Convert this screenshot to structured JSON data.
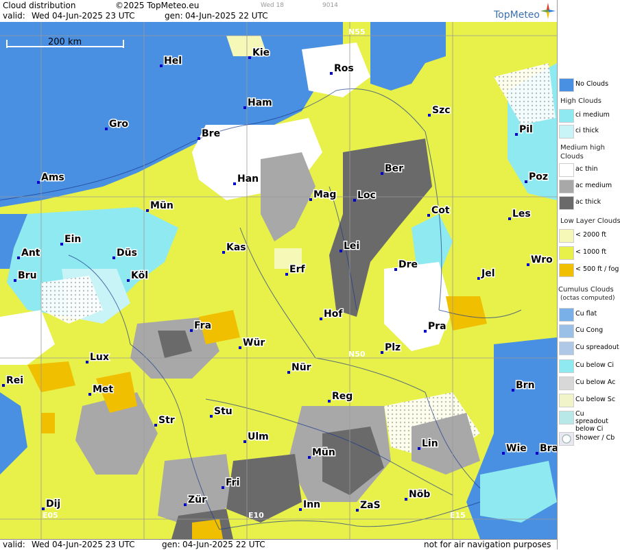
{
  "header": {
    "product": "Cloud distribution",
    "copyright": "©2025 TopMeteo.eu",
    "small_tag_1": "Wed 18",
    "small_tag_2": "9014",
    "valid_label": "valid:",
    "valid_value": "Wed  04-Jun-2025  23 UTC",
    "gen_label": "gen:",
    "gen_value": "04-Jun-2025 22 UTC",
    "brand": "TopMeteo"
  },
  "footer": {
    "valid_label": "valid:",
    "valid_value": "Wed  04-Jun-2025  23 UTC",
    "gen_label": "gen:",
    "gen_value": "04-Jun-2025 22 UTC",
    "disclaimer": "not for air navigation purposes"
  },
  "scale_bar": {
    "label": "200 km"
  },
  "grid_labels": {
    "n55": "N55",
    "n50": "N50",
    "e05": "E05",
    "e10": "E10",
    "e15": "E15"
  },
  "colors": {
    "no_clouds": "#4a90e2",
    "ci_medium": "#8eeaf0",
    "ci_thick": "#c8f4f8",
    "ac_thin": "#ffffff",
    "ac_medium": "#a8a8a8",
    "ac_thick": "#6a6a6a",
    "low_2000": "#f6f8b8",
    "low_1000": "#e8f04a",
    "low_500": "#f0c000",
    "city_marker": "#0000cc"
  },
  "cities": [
    {
      "id": "hel",
      "name": "Hel"
    },
    {
      "id": "kie",
      "name": "Kie"
    },
    {
      "id": "ros",
      "name": "Ros"
    },
    {
      "id": "ham",
      "name": "Ham"
    },
    {
      "id": "szc",
      "name": "Szc"
    },
    {
      "id": "gro",
      "name": "Gro"
    },
    {
      "id": "bre",
      "name": "Bre"
    },
    {
      "id": "pil",
      "name": "Pil"
    },
    {
      "id": "ber",
      "name": "Ber"
    },
    {
      "id": "ams",
      "name": "Ams"
    },
    {
      "id": "han",
      "name": "Han"
    },
    {
      "id": "poz",
      "name": "Poz"
    },
    {
      "id": "mag",
      "name": "Mag"
    },
    {
      "id": "loc",
      "name": "Loc"
    },
    {
      "id": "mun_n",
      "name": "Mün"
    },
    {
      "id": "cot",
      "name": "Cot"
    },
    {
      "id": "les",
      "name": "Les"
    },
    {
      "id": "ein",
      "name": "Ein"
    },
    {
      "id": "kas",
      "name": "Kas"
    },
    {
      "id": "lei",
      "name": "Lei"
    },
    {
      "id": "ant",
      "name": "Ant"
    },
    {
      "id": "dus",
      "name": "Düs"
    },
    {
      "id": "wro",
      "name": "Wro"
    },
    {
      "id": "dre",
      "name": "Dre"
    },
    {
      "id": "erf",
      "name": "Erf"
    },
    {
      "id": "bru",
      "name": "Bru"
    },
    {
      "id": "kol",
      "name": "Köl"
    },
    {
      "id": "jel",
      "name": "Jel"
    },
    {
      "id": "hof",
      "name": "Hof"
    },
    {
      "id": "fra",
      "name": "Fra"
    },
    {
      "id": "pra",
      "name": "Pra"
    },
    {
      "id": "wur",
      "name": "Wür"
    },
    {
      "id": "lux",
      "name": "Lux"
    },
    {
      "id": "plz",
      "name": "Plz"
    },
    {
      "id": "nur",
      "name": "Nür"
    },
    {
      "id": "rei",
      "name": "Rei"
    },
    {
      "id": "met",
      "name": "Met"
    },
    {
      "id": "brn",
      "name": "Brn"
    },
    {
      "id": "reg",
      "name": "Reg"
    },
    {
      "id": "stu",
      "name": "Stu"
    },
    {
      "id": "str",
      "name": "Str"
    },
    {
      "id": "lin",
      "name": "Lin"
    },
    {
      "id": "ulm",
      "name": "Ulm"
    },
    {
      "id": "mun_s",
      "name": "Mün"
    },
    {
      "id": "wie",
      "name": "Wie"
    },
    {
      "id": "bra",
      "name": "Bra"
    },
    {
      "id": "fri",
      "name": "Fri"
    },
    {
      "id": "nob",
      "name": "Nöb"
    },
    {
      "id": "dij",
      "name": "Dij"
    },
    {
      "id": "zur",
      "name": "Zür"
    },
    {
      "id": "inn",
      "name": "Inn"
    },
    {
      "id": "zas",
      "name": "ZaS"
    }
  ],
  "legend": {
    "no_clouds": "No Clouds",
    "high_clouds": "High Clouds",
    "ci_medium": "ci medium",
    "ci_thick": "ci thick",
    "medium_high": "Medium high Clouds",
    "ac_thin": "ac thin",
    "ac_medium": "ac medium",
    "ac_thick": "ac thick",
    "low_layer": "Low Layer Clouds",
    "low_2000": "< 2000 ft",
    "low_1000": "< 1000 ft",
    "low_500": "< 500 ft / fog",
    "cumulus": "Cumulus Clouds",
    "cumulus_sub": "(octas computed)",
    "cu_flat": "Cu flat",
    "cu_cong": "Cu Cong",
    "cu_spreadout": "Cu spreadout",
    "cu_below_ci": "Cu below Ci",
    "cu_below_ac": "Cu below Ac",
    "cu_below_sc": "Cu below Sc",
    "cu_spreadout_below_ci": "Cu spreadout below Ci",
    "shower_cb": "Shower / Cb"
  }
}
